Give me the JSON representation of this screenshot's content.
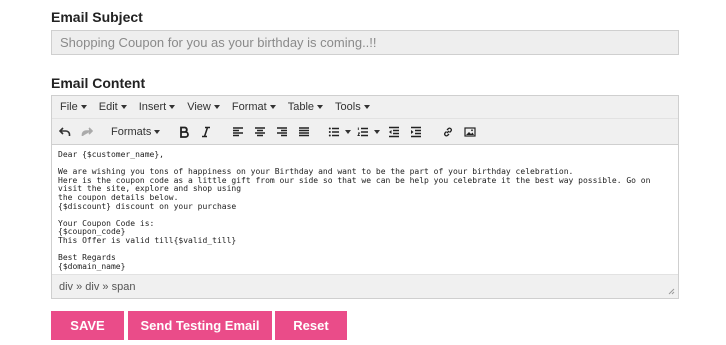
{
  "form": {
    "subject_label": "Email Subject",
    "subject_value": "Shopping Coupon for you as your birthday is coming..!!",
    "content_label": "Email Content"
  },
  "editor": {
    "menus": [
      "File",
      "Edit",
      "Insert",
      "View",
      "Format",
      "Table",
      "Tools"
    ],
    "formats_label": "Formats",
    "content_lines": [
      "Dear {$customer_name},",
      "",
      "We are wishing you tons of happiness on your Birthday and want to be the part of your birthday celebration.",
      "Here is the coupon code as a little gift from our side so that we can be help you celebrate it the best way possible. Go on visit the site, explore and shop using",
      "the coupon details below.",
      "{$discount} discount on your purchase",
      "",
      "Your Coupon Code is:",
      "{$coupon_code}",
      "This Offer is valid till{$valid_till}",
      "",
      "Best Regards",
      "{$domain_name}"
    ],
    "status_path": "div » div » span"
  },
  "buttons": {
    "save": "SAVE",
    "test": "Send Testing Email",
    "reset": "Reset"
  },
  "colors": {
    "accent": "#ea4c89"
  }
}
